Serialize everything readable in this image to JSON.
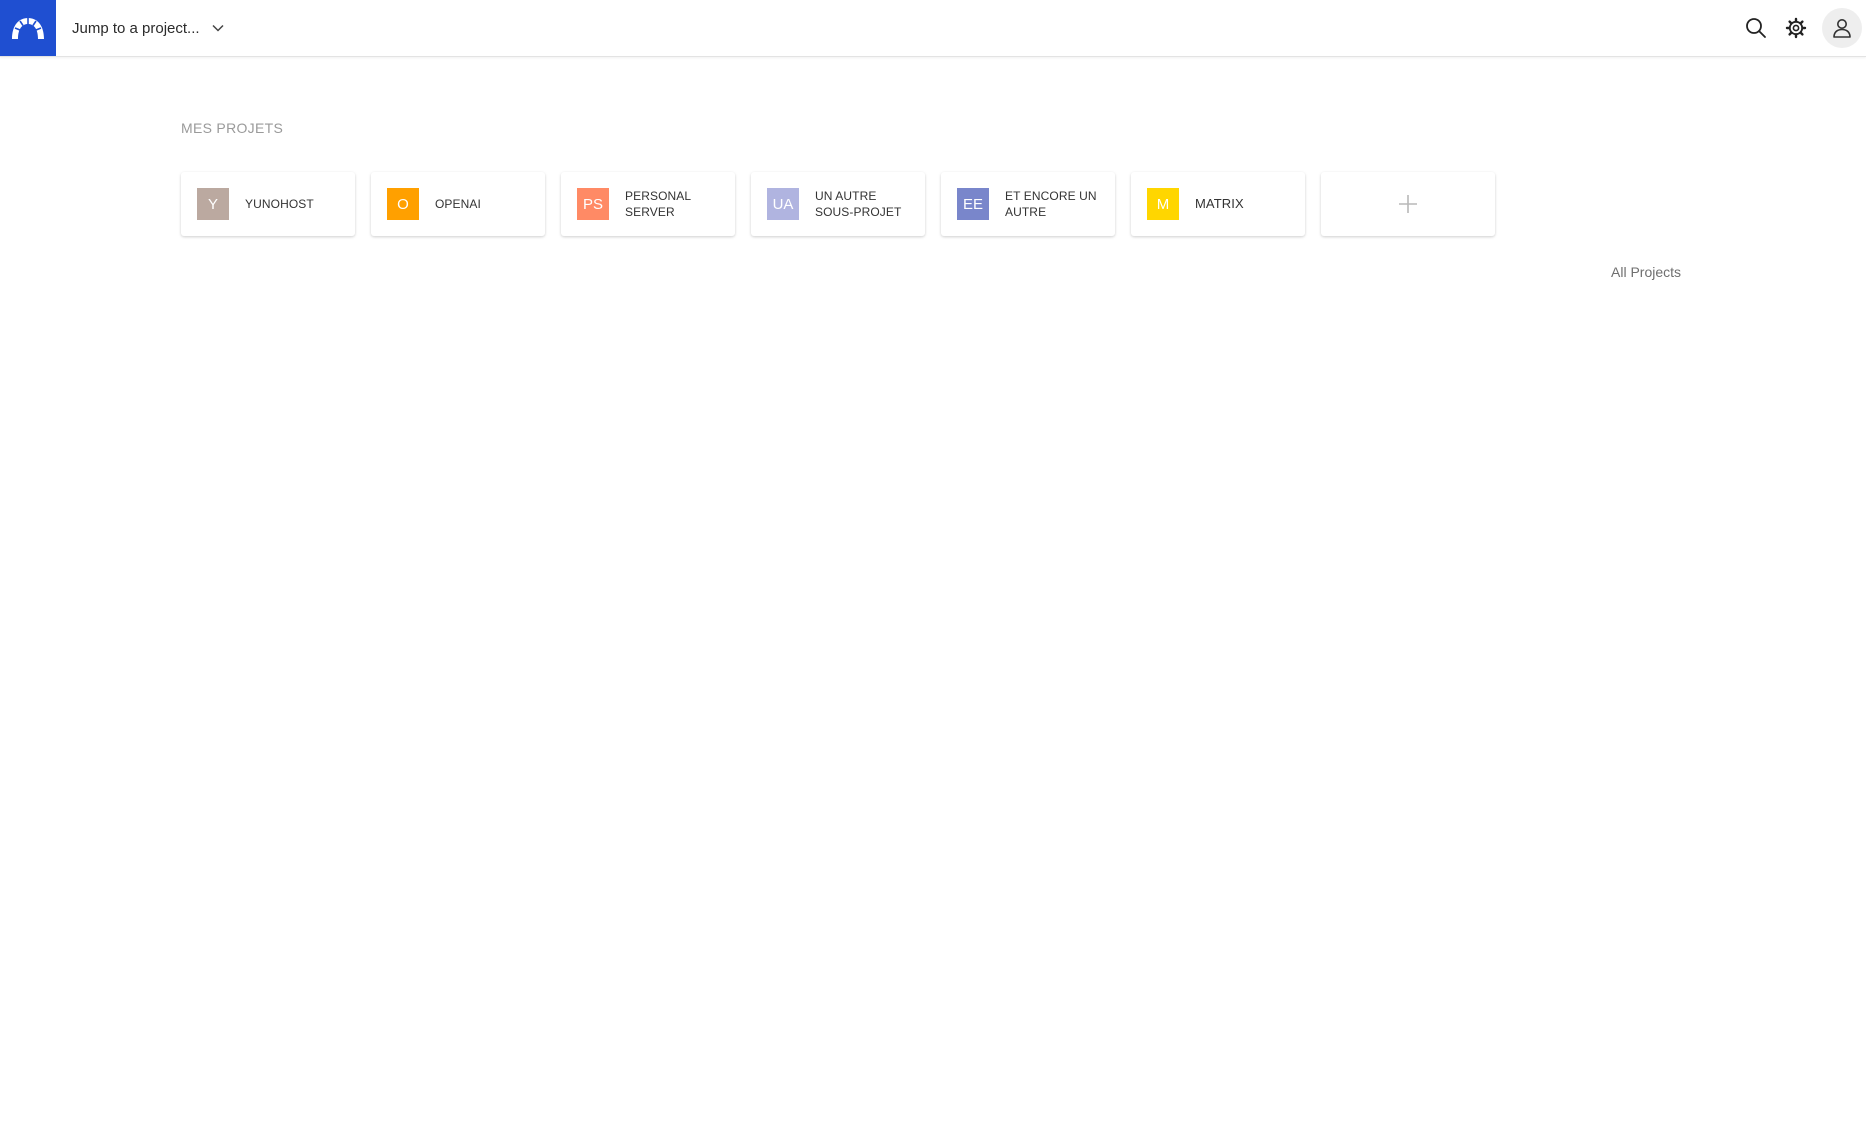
{
  "header": {
    "logo_icon": "arch-logo-icon",
    "brand_color": "#1f4fd1",
    "project_jump_label": "Jump to a project...",
    "icons": [
      "search-icon",
      "gear-icon",
      "user-icon"
    ]
  },
  "main": {
    "section_title": "MES PROJETS",
    "projects": [
      {
        "initials": "Y",
        "line1": "YUNOHOST",
        "line2": "",
        "color": "#bba9a0"
      },
      {
        "initials": "O",
        "line1": "OPENAI",
        "line2": "",
        "color": "#ffa000"
      },
      {
        "initials": "PS",
        "line1": "PERSONAL",
        "line2": "SERVER",
        "color": "#ff8a65"
      },
      {
        "initials": "UA",
        "line1": "UN AUTRE",
        "line2": "SOUS-PROJET",
        "color": "#b0b4e0"
      },
      {
        "initials": "EE",
        "line1": "ET ENCORE UN",
        "line2": "AUTRE",
        "color": "#7986cb"
      },
      {
        "initials": "M",
        "line1": "MATRIX",
        "line2": "",
        "color": "#ffd600"
      }
    ],
    "add_icon": "plus-icon",
    "all_projects_label": "All Projects"
  }
}
